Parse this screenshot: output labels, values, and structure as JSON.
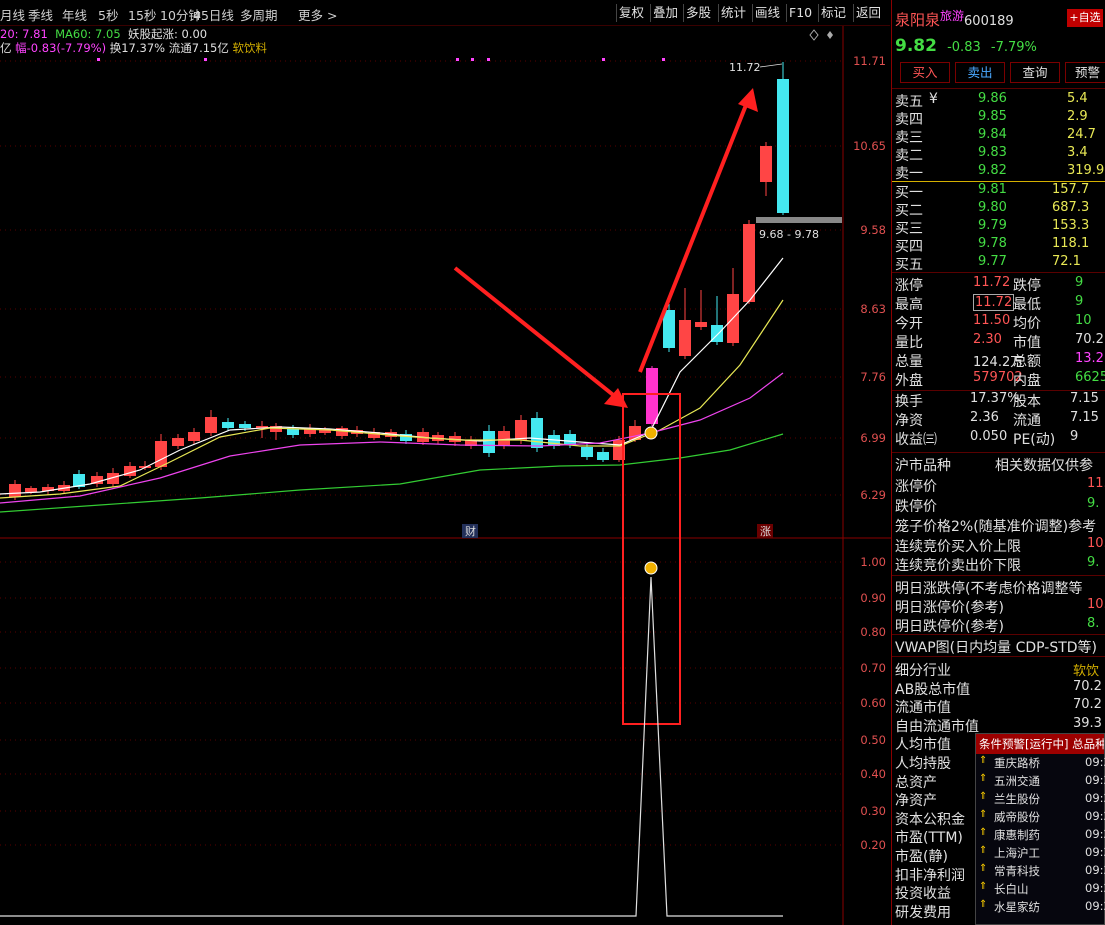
{
  "toolbar": {
    "left_items": [
      "月线",
      "季线",
      "年线",
      "5秒",
      "15秒",
      "10分钟",
      "45日线",
      "多周期",
      "更多 >"
    ],
    "right_buttons": [
      "复权",
      "叠加",
      "多股",
      "统计",
      "画线",
      "F10",
      "标记",
      "返回"
    ]
  },
  "indicators": {
    "ma20": "20: 7.81",
    "ma60": "MA60: 7.05",
    "yaogu": "妖股起涨: 0.00",
    "amp_prefix": "亿",
    "change": "幅-0.83(-7.79%)",
    "turnover": "换17.37%",
    "float_cap": "流通7.15亿",
    "industry": "软饮料"
  },
  "price_axis": [
    "11.71",
    "10.65",
    "9.58",
    "8.63",
    "7.76",
    "6.99",
    "6.29"
  ],
  "lower_axis": [
    "1.00",
    "0.90",
    "0.80",
    "0.70",
    "0.60",
    "0.50",
    "0.40",
    "0.30",
    "0.20"
  ],
  "annotations": {
    "high_label": "11.72",
    "range_label": "9.68 - 9.78",
    "marker_cai": "财",
    "marker_zhang": "涨"
  },
  "colors": {
    "up": "#ff4545",
    "down": "#44e8f0",
    "ma5": "#ffffff",
    "ma10": "#e8e855",
    "ma20": "#ee44ee",
    "ma60": "#33cc33",
    "accent": "#9c0000"
  },
  "quote": {
    "name": "泉阳泉",
    "tag": "旅游",
    "code": "600189",
    "add_button": "+自选",
    "price": "9.82",
    "change": "-0.83",
    "change_pct": "-7.79%",
    "buttons": [
      "买入",
      "卖出",
      "查询",
      "预警"
    ],
    "asks": [
      {
        "label": "卖五",
        "price": "9.86",
        "vol": "5.4",
        "extra": "¥"
      },
      {
        "label": "卖四",
        "price": "9.85",
        "vol": "2.9",
        "extra": ""
      },
      {
        "label": "卖三",
        "price": "9.84",
        "vol": "24.7",
        "extra": ""
      },
      {
        "label": "卖二",
        "price": "9.83",
        "vol": "3.4",
        "extra": ""
      },
      {
        "label": "卖一",
        "price": "9.82",
        "vol": "319.9",
        "extra": ""
      }
    ],
    "bids": [
      {
        "label": "买一",
        "price": "9.81",
        "vol": "157.7"
      },
      {
        "label": "买二",
        "price": "9.80",
        "vol": "687.3"
      },
      {
        "label": "买三",
        "price": "9.79",
        "vol": "153.3"
      },
      {
        "label": "买四",
        "price": "9.78",
        "vol": "118.1"
      },
      {
        "label": "买五",
        "price": "9.77",
        "vol": "72.1"
      }
    ],
    "stats": [
      {
        "l1": "涨停",
        "v1": "11.72",
        "l2": "跌停",
        "v2": "9"
      },
      {
        "l1": "最高",
        "v1": "11.72",
        "l2": "最低",
        "v2": "9"
      },
      {
        "l1": "今开",
        "v1": "11.50",
        "l2": "均价",
        "v2": "10"
      },
      {
        "l1": "量比",
        "v1": "2.30",
        "l2": "市值",
        "v2": "70.2"
      },
      {
        "l1": "总量",
        "v1": "124.2万",
        "l2": "总额",
        "v2": "13.2"
      },
      {
        "l1": "外盘",
        "v1": "579702",
        "l2": "内盘",
        "v2": "6625"
      }
    ],
    "stats2": [
      {
        "l1": "换手",
        "v1": "17.37%",
        "l2": "股本",
        "v2": "7.15"
      },
      {
        "l1": "净资",
        "v1": "2.36",
        "l2": "流通",
        "v2": "7.15"
      },
      {
        "l1": "收益㈢",
        "v1": "0.050",
        "l2": "PE(动)",
        "v2": "9"
      }
    ],
    "product_title": "沪市品种",
    "product_note": "相关数据仅供参",
    "limit_up_label": "涨停价",
    "limit_up_val": "11.",
    "limit_down_label": "跌停价",
    "limit_down_val": "9.",
    "cage_label": "笼子价格2%(随基准价调整)参考",
    "auction_buy_label": "连续竞价买入价上限",
    "auction_buy_val": "10.",
    "auction_sell_label": "连续竞价卖出价下限",
    "auction_sell_val": "9.",
    "tomorrow_label": "明日涨跌停(不考虑价格调整等",
    "tomorrow_up_label": "明日涨停价(参考)",
    "tomorrow_up_val": "10.",
    "tomorrow_down_label": "明日跌停价(参考)",
    "tomorrow_down_val": "8.",
    "vwap_label": "VWAP图(日内均量 CDP-STD等)",
    "fund": [
      {
        "l": "细分行业",
        "v": "软饮"
      },
      {
        "l": "AB股总市值",
        "v": "70.2"
      },
      {
        "l": "流通市值",
        "v": "70.2"
      },
      {
        "l": "自由流通市值",
        "v": "39.3"
      },
      {
        "l": "人均市值",
        "v": ""
      },
      {
        "l": "人均持股",
        "v": ""
      },
      {
        "l": "总资产",
        "v": ""
      },
      {
        "l": "净资产",
        "v": ""
      },
      {
        "l": "资本公积金",
        "v": ""
      },
      {
        "l": "市盈(TTM)",
        "v": ""
      },
      {
        "l": "市盈(静)",
        "v": ""
      },
      {
        "l": "扣非净利润",
        "v": ""
      },
      {
        "l": "投资收益",
        "v": ""
      },
      {
        "l": "研发费用",
        "v": ""
      }
    ]
  },
  "alerts": {
    "title": "条件预警[运行中] 总品种",
    "items": [
      {
        "name": "重庆路桥",
        "time": "09:2"
      },
      {
        "name": "五洲交通",
        "time": "09:2"
      },
      {
        "name": "兰生股份",
        "time": "09:2"
      },
      {
        "name": "威帝股份",
        "time": "09:2"
      },
      {
        "name": "康惠制药",
        "time": "09:2"
      },
      {
        "name": "上海沪工",
        "time": "09:2"
      },
      {
        "name": "常青科技",
        "time": "09:2"
      },
      {
        "name": "长白山",
        "time": "09:2"
      },
      {
        "name": "水星家纺",
        "time": "09:2"
      }
    ]
  }
}
